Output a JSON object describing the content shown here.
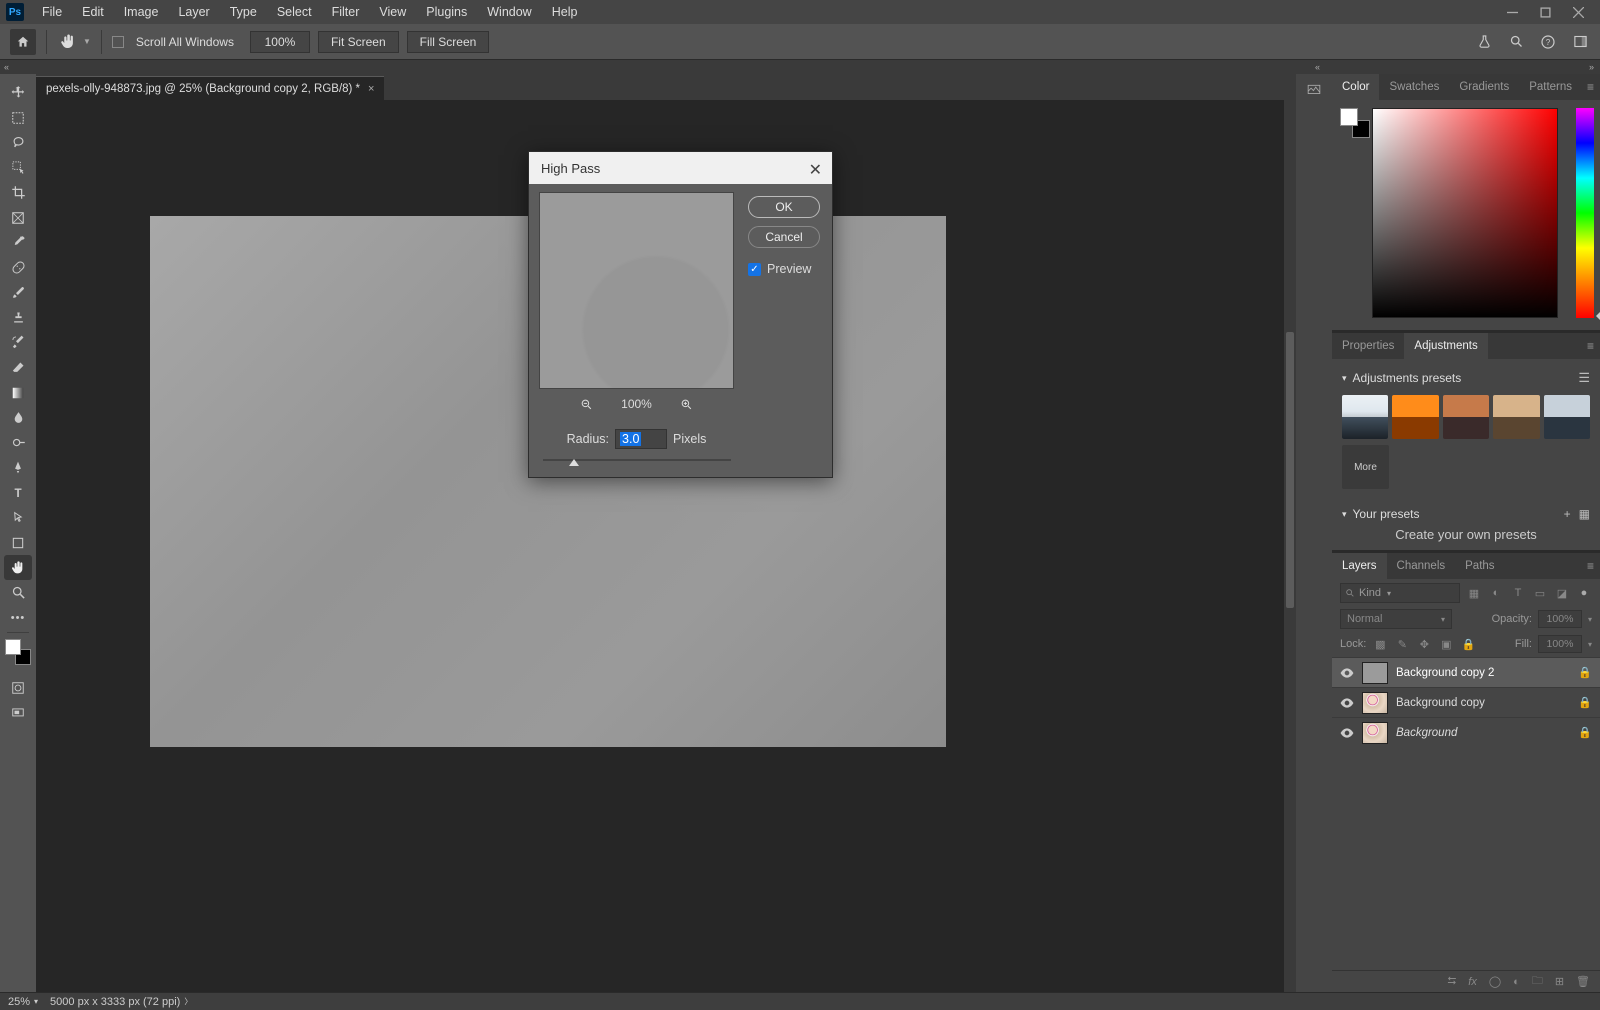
{
  "menu": [
    "File",
    "Edit",
    "Image",
    "Layer",
    "Type",
    "Select",
    "Filter",
    "View",
    "Plugins",
    "Window",
    "Help"
  ],
  "optionsBar": {
    "scrollAllWindows": "Scroll All Windows",
    "zoom": "100%",
    "fitScreen": "Fit Screen",
    "fillScreen": "Fill Screen"
  },
  "documentTab": {
    "title": "pexels-olly-948873.jpg @ 25% (Background copy 2, RGB/8) *"
  },
  "dialog": {
    "title": "High Pass",
    "ok": "OK",
    "cancel": "Cancel",
    "previewLabel": "Preview",
    "previewChecked": true,
    "zoom": "100%",
    "radiusLabel": "Radius:",
    "radiusValue": "3.0",
    "radiusUnit": "Pixels"
  },
  "panels": {
    "colorTabs": [
      "Color",
      "Swatches",
      "Gradients",
      "Patterns"
    ],
    "adjTabs": [
      "Properties",
      "Adjustments"
    ],
    "adj": {
      "presetsHeader": "Adjustments presets",
      "moreLabel": "More",
      "yourHeader": "Your presets",
      "yourHint": "Create your own presets"
    },
    "layerTabs": [
      "Layers",
      "Channels",
      "Paths"
    ],
    "layers": {
      "kind": "Kind",
      "blend": "Normal",
      "opacityLabel": "Opacity:",
      "opacityValue": "100%",
      "lockLabel": "Lock:",
      "fillLabel": "Fill:",
      "fillValue": "100%",
      "items": [
        {
          "name": "Background copy 2",
          "locked": true,
          "selected": true,
          "thumb": "gray"
        },
        {
          "name": "Background copy",
          "locked": true,
          "selected": false,
          "thumb": "portrait"
        },
        {
          "name": "Background",
          "locked": true,
          "selected": false,
          "thumb": "portrait",
          "italic": true
        }
      ]
    }
  },
  "statusBar": {
    "zoom": "25%",
    "dims": "5000 px x 3333 px (72 ppi)"
  }
}
